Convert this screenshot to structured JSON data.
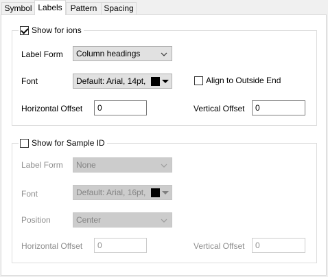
{
  "tabs": [
    {
      "label": "Symbol"
    },
    {
      "label": "Labels"
    },
    {
      "label": "Pattern"
    },
    {
      "label": "Spacing"
    }
  ],
  "ions_group": {
    "title": "Show for ions",
    "checked": true,
    "label_form_label": "Label Form",
    "label_form_value": "Column headings",
    "font_label": "Font",
    "font_value": "Default: Arial, 14pt,",
    "font_color": "#000000",
    "align_label": "Align to Outside End",
    "align_checked": false,
    "h_offset_label": "Horizontal Offset",
    "h_offset_value": "0",
    "v_offset_label": "Vertical Offset",
    "v_offset_value": "0"
  },
  "sample_group": {
    "title": "Show for Sample ID",
    "checked": false,
    "label_form_label": "Label Form",
    "label_form_value": "None",
    "font_label": "Font",
    "font_value": "Default: Arial, 16pt,",
    "font_color": "#000000",
    "position_label": "Position",
    "position_value": "Center",
    "h_offset_label": "Horizontal Offset",
    "h_offset_value": "0",
    "v_offset_label": "Vertical Offset",
    "v_offset_value": "0"
  }
}
